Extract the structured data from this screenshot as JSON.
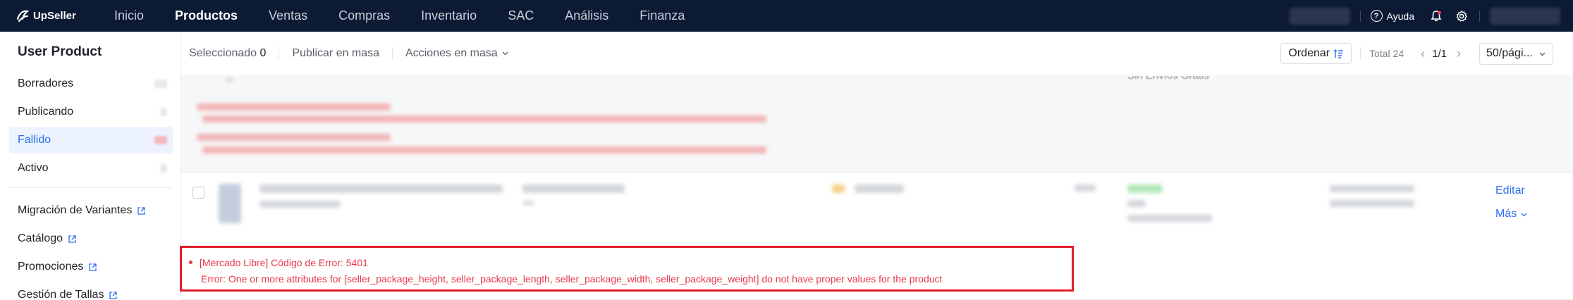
{
  "app": {
    "name": "UpSeller"
  },
  "topnav": {
    "items": [
      {
        "label": "Inicio",
        "active": false
      },
      {
        "label": "Productos",
        "active": true
      },
      {
        "label": "Ventas",
        "active": false
      },
      {
        "label": "Compras",
        "active": false
      },
      {
        "label": "Inventario",
        "active": false
      },
      {
        "label": "SAC",
        "active": false
      },
      {
        "label": "Análisis",
        "active": false
      },
      {
        "label": "Finanza",
        "active": false
      }
    ],
    "help_label": "Ayuda",
    "icons": [
      "help-circle-icon",
      "bell-icon",
      "gear-icon"
    ]
  },
  "sidebar": {
    "title": "User Product",
    "status_items": [
      {
        "label": "Borradores",
        "active": false
      },
      {
        "label": "Publicando",
        "active": false
      },
      {
        "label": "Fallido",
        "active": true
      },
      {
        "label": "Activo",
        "active": false
      }
    ],
    "links": [
      {
        "label": "Migración de Variantes"
      },
      {
        "label": "Catálogo"
      },
      {
        "label": "Promociones"
      },
      {
        "label": "Gestión de Tallas"
      }
    ]
  },
  "toolbar": {
    "selected_label": "Seleccionado",
    "selected_count": "0",
    "publish_mass": "Publicar en masa",
    "mass_actions": "Acciones en masa",
    "order_label": "Ordenar",
    "total_label": "Total 24",
    "page_indicator": "1/1",
    "page_size": "50/pági..."
  },
  "content": {
    "prev_row_partial_text": "Sin Envíos Gratis",
    "row_actions": {
      "edit": "Editar",
      "more": "Más"
    },
    "error": {
      "source": "[Mercado Libre] Código de Error: 5401",
      "message": "Error: One or more attributes for [seller_package_height, seller_package_length, seller_package_width, seller_package_weight] do not have proper values for the product"
    }
  },
  "colors": {
    "topbar_bg": "#0c1a34",
    "accent": "#2d6ff0",
    "error": "#e8384f",
    "highlight_border": "#e11d2a"
  }
}
